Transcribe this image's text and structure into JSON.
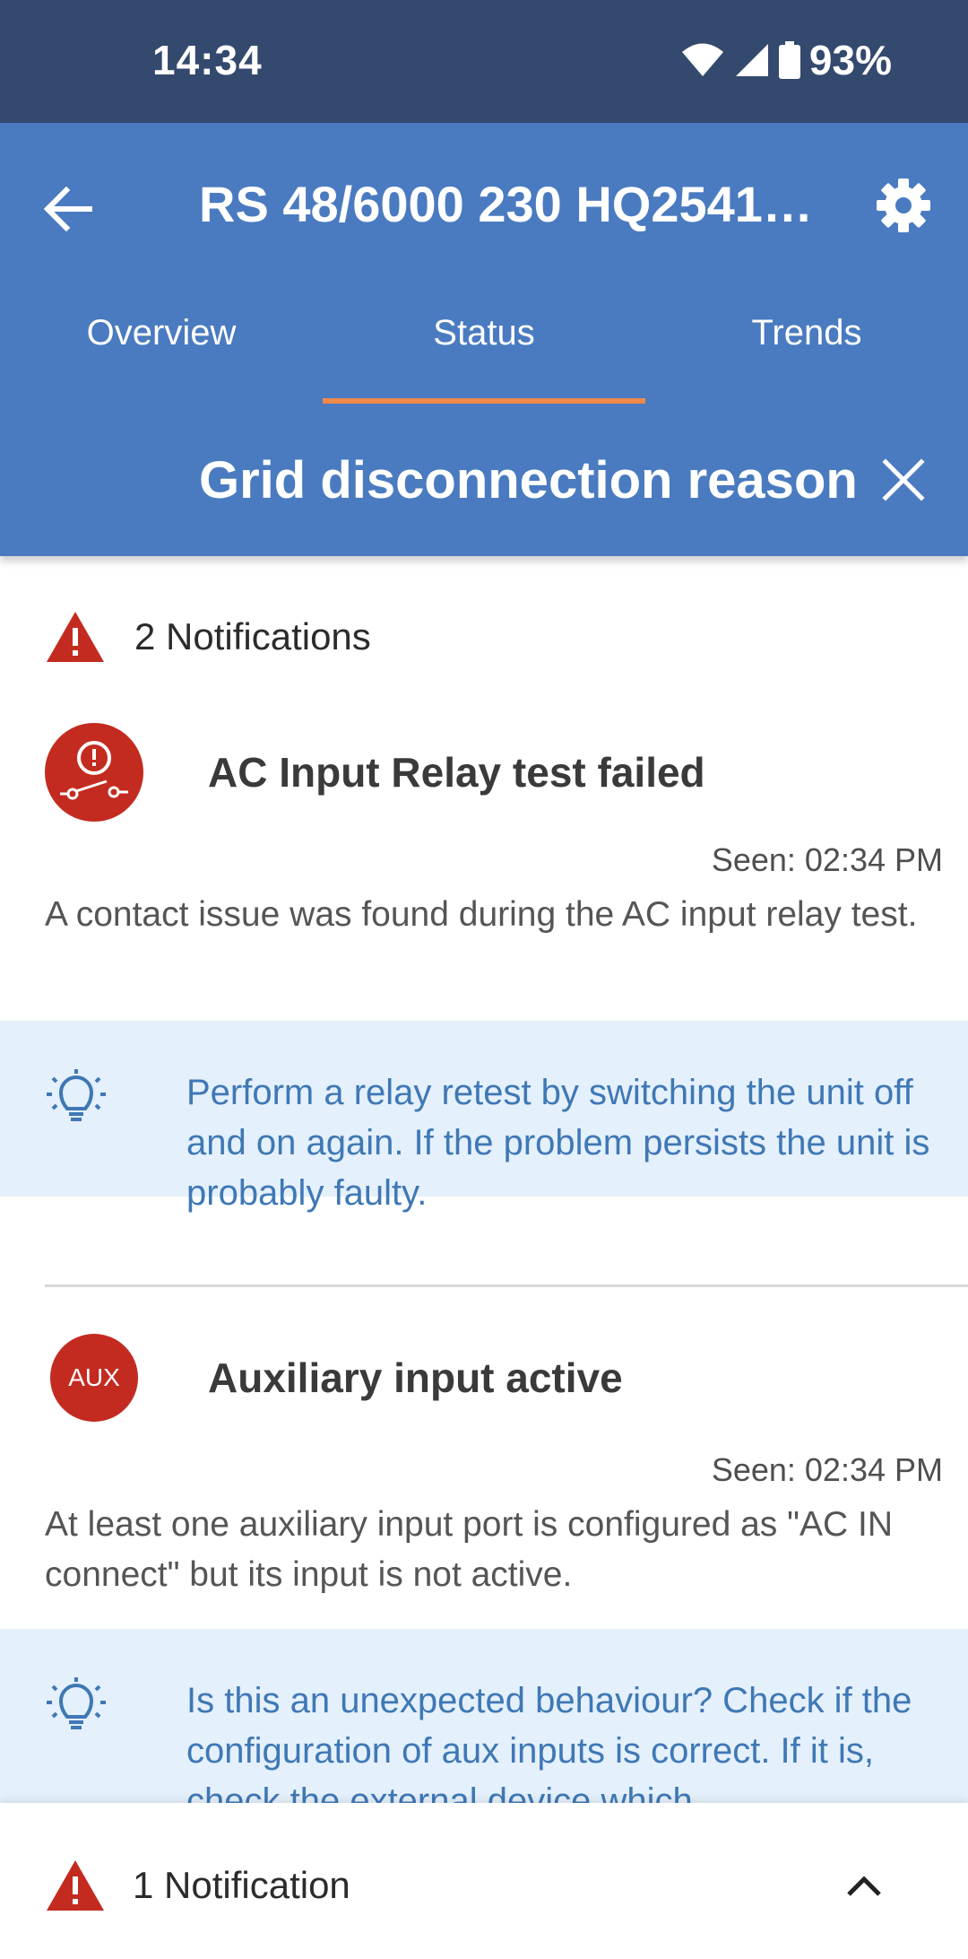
{
  "status_bar": {
    "time": "14:34",
    "battery": "93%",
    "icons": [
      "wifi-icon",
      "signal-icon",
      "battery-icon"
    ]
  },
  "app_bar": {
    "title": "RS 48/6000 230 HQ2541…",
    "back_icon": "arrow-left-icon",
    "settings_icon": "gear-icon",
    "tabs": [
      {
        "label": "Overview",
        "active": false
      },
      {
        "label": "Status",
        "active": true
      },
      {
        "label": "Trends",
        "active": false
      }
    ]
  },
  "banner": {
    "title": "Grid disconnection reason",
    "close_icon": "close-icon"
  },
  "notifications_header": {
    "label": "2 Notifications",
    "icon": "warning-triangle-icon"
  },
  "notifications": [
    {
      "icon": "relay-alert-icon",
      "title": "AC Input Relay test failed",
      "seen": "Seen: 02:34 PM",
      "description": "A contact issue was found during the AC input relay test.",
      "tip": "Perform a relay retest by switching the unit off and on again. If the problem persists the unit is probably faulty."
    },
    {
      "icon_text": "AUX",
      "title": "Auxiliary input active",
      "seen": "Seen: 02:34 PM",
      "description": "At least one auxiliary input port is configured as \"AC IN connect\" but its input is not active.",
      "tip": "Is this an unexpected behaviour? Check if the configuration of aux inputs is correct. If it is, check the external device which"
    }
  ],
  "bottom_bar": {
    "label": "1 Notification",
    "icon": "warning-triangle-icon",
    "expand_icon": "chevron-up-icon"
  },
  "colors": {
    "status_bar": "#34496e",
    "app_bar": "#4a7bc0",
    "tab_indicator": "#f08a4b",
    "alert_red": "#c42b20",
    "tip_background": "#e4f0fb",
    "tip_text": "#3f78b5"
  }
}
